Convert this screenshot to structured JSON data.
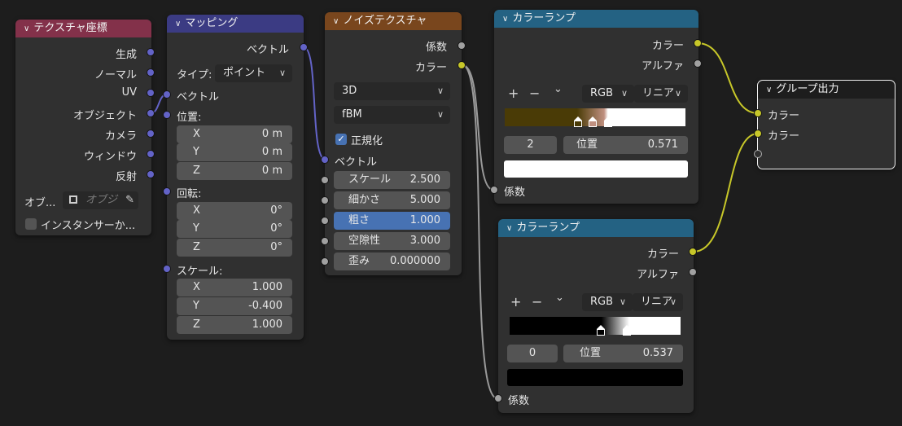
{
  "nodes": {
    "texcoord": {
      "title": "テクスチャ座標",
      "outputs": [
        "生成",
        "ノーマル",
        "UV",
        "オブジェクト",
        "カメラ",
        "ウィンドウ",
        "反射"
      ],
      "object_label": "オブ...",
      "object_placeholder": "オブジ",
      "instancer_label": "インスタンサーか..."
    },
    "mapping": {
      "title": "マッピング",
      "output": "ベクトル",
      "type_label": "タイプ:",
      "type_value": "ポイント",
      "vector_label": "ベクトル",
      "location_label": "位置:",
      "location": [
        {
          "axis": "X",
          "value": "0 m"
        },
        {
          "axis": "Y",
          "value": "0 m"
        },
        {
          "axis": "Z",
          "value": "0 m"
        }
      ],
      "rotation_label": "回転:",
      "rotation": [
        {
          "axis": "X",
          "value": "0°"
        },
        {
          "axis": "Y",
          "value": "0°"
        },
        {
          "axis": "Z",
          "value": "0°"
        }
      ],
      "scale_label": "スケール:",
      "scale": [
        {
          "axis": "X",
          "value": "1.000"
        },
        {
          "axis": "Y",
          "value": "-0.400"
        },
        {
          "axis": "Z",
          "value": "1.000"
        }
      ]
    },
    "noise": {
      "title": "ノイズテクスチャ",
      "outputs": [
        "係数",
        "カラー"
      ],
      "dimension": "3D",
      "type": "fBM",
      "normalize_label": "正規化",
      "normalize_checked": true,
      "vector_label": "ベクトル",
      "params": [
        {
          "label": "スケール",
          "value": "2.500"
        },
        {
          "label": "細かさ",
          "value": "5.000"
        },
        {
          "label": "粗さ",
          "value": "1.000"
        },
        {
          "label": "空隙性",
          "value": "3.000"
        },
        {
          "label": "歪み",
          "value": "0.000000"
        }
      ]
    },
    "ramp1": {
      "title": "カラーランプ",
      "outputs": [
        "カラー",
        "アルファ"
      ],
      "plus": "+",
      "minus": "−",
      "dropdown_arrow": "⌄",
      "color_mode": "RGB",
      "interpolation": "リニア",
      "index": "2",
      "pos_label": "位置",
      "pos_value": "0.571",
      "input_label": "係数",
      "swatch_color": "#ffffff"
    },
    "ramp2": {
      "title": "カラーランプ",
      "outputs": [
        "カラー",
        "アルファ"
      ],
      "plus": "+",
      "minus": "−",
      "dropdown_arrow": "⌄",
      "color_mode": "RGB",
      "interpolation": "リニア",
      "index": "0",
      "pos_label": "位置",
      "pos_value": "0.537",
      "input_label": "係数",
      "swatch_color": "#000000"
    },
    "group_out": {
      "title": "グループ出力",
      "inputs": [
        "カラー",
        "カラー"
      ]
    }
  },
  "colors": {
    "header_input": "#83314a",
    "header_vector": "#3b3b83",
    "header_texture": "#79461d",
    "header_converter": "#246283",
    "header_group": "#1d1d1d",
    "socket_vector": "#6363c7",
    "socket_color": "#c7c729",
    "socket_float": "#a1a1a1",
    "selected_field": "#4772b3"
  },
  "icons": {
    "collapse": "chevron-down-icon",
    "eyedropper": "eyedropper-icon",
    "object": "object-icon",
    "checkbox": "checkmark-icon"
  }
}
